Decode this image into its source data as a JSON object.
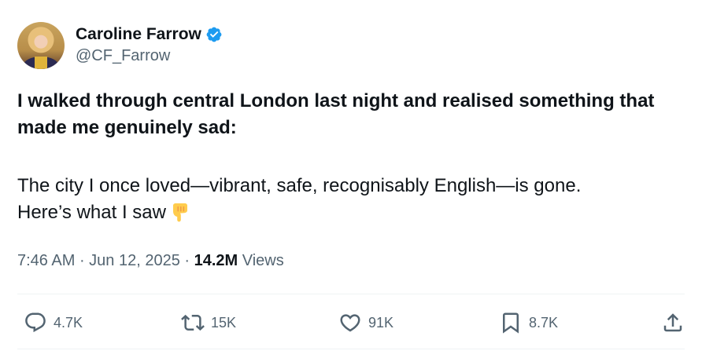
{
  "author": {
    "display_name": "Caroline Farrow",
    "handle": "@CF_Farrow",
    "avatar_icon": "profile-photo",
    "verified_icon": "verified-badge-icon",
    "verified_color": "#1d9bf0"
  },
  "tweet": {
    "line1": "I walked through central London last night and realised something that made me genuinely sad:",
    "line2": "The city I once loved—vibrant, safe, recognisably English—is gone.",
    "line3": "Here’s what I saw",
    "emoji": "backhand-index-pointing-down"
  },
  "meta": {
    "time": "7:46 AM",
    "separator": " · ",
    "date": "Jun 12, 2025",
    "views_count": "14.2M",
    "views_label": " Views"
  },
  "actions": {
    "replies": "4.7K",
    "reposts": "15K",
    "likes": "91K",
    "bookmarks": "8.7K"
  },
  "colors": {
    "text": "#0f1419",
    "muted": "#536471",
    "divider": "#eff3f4"
  }
}
